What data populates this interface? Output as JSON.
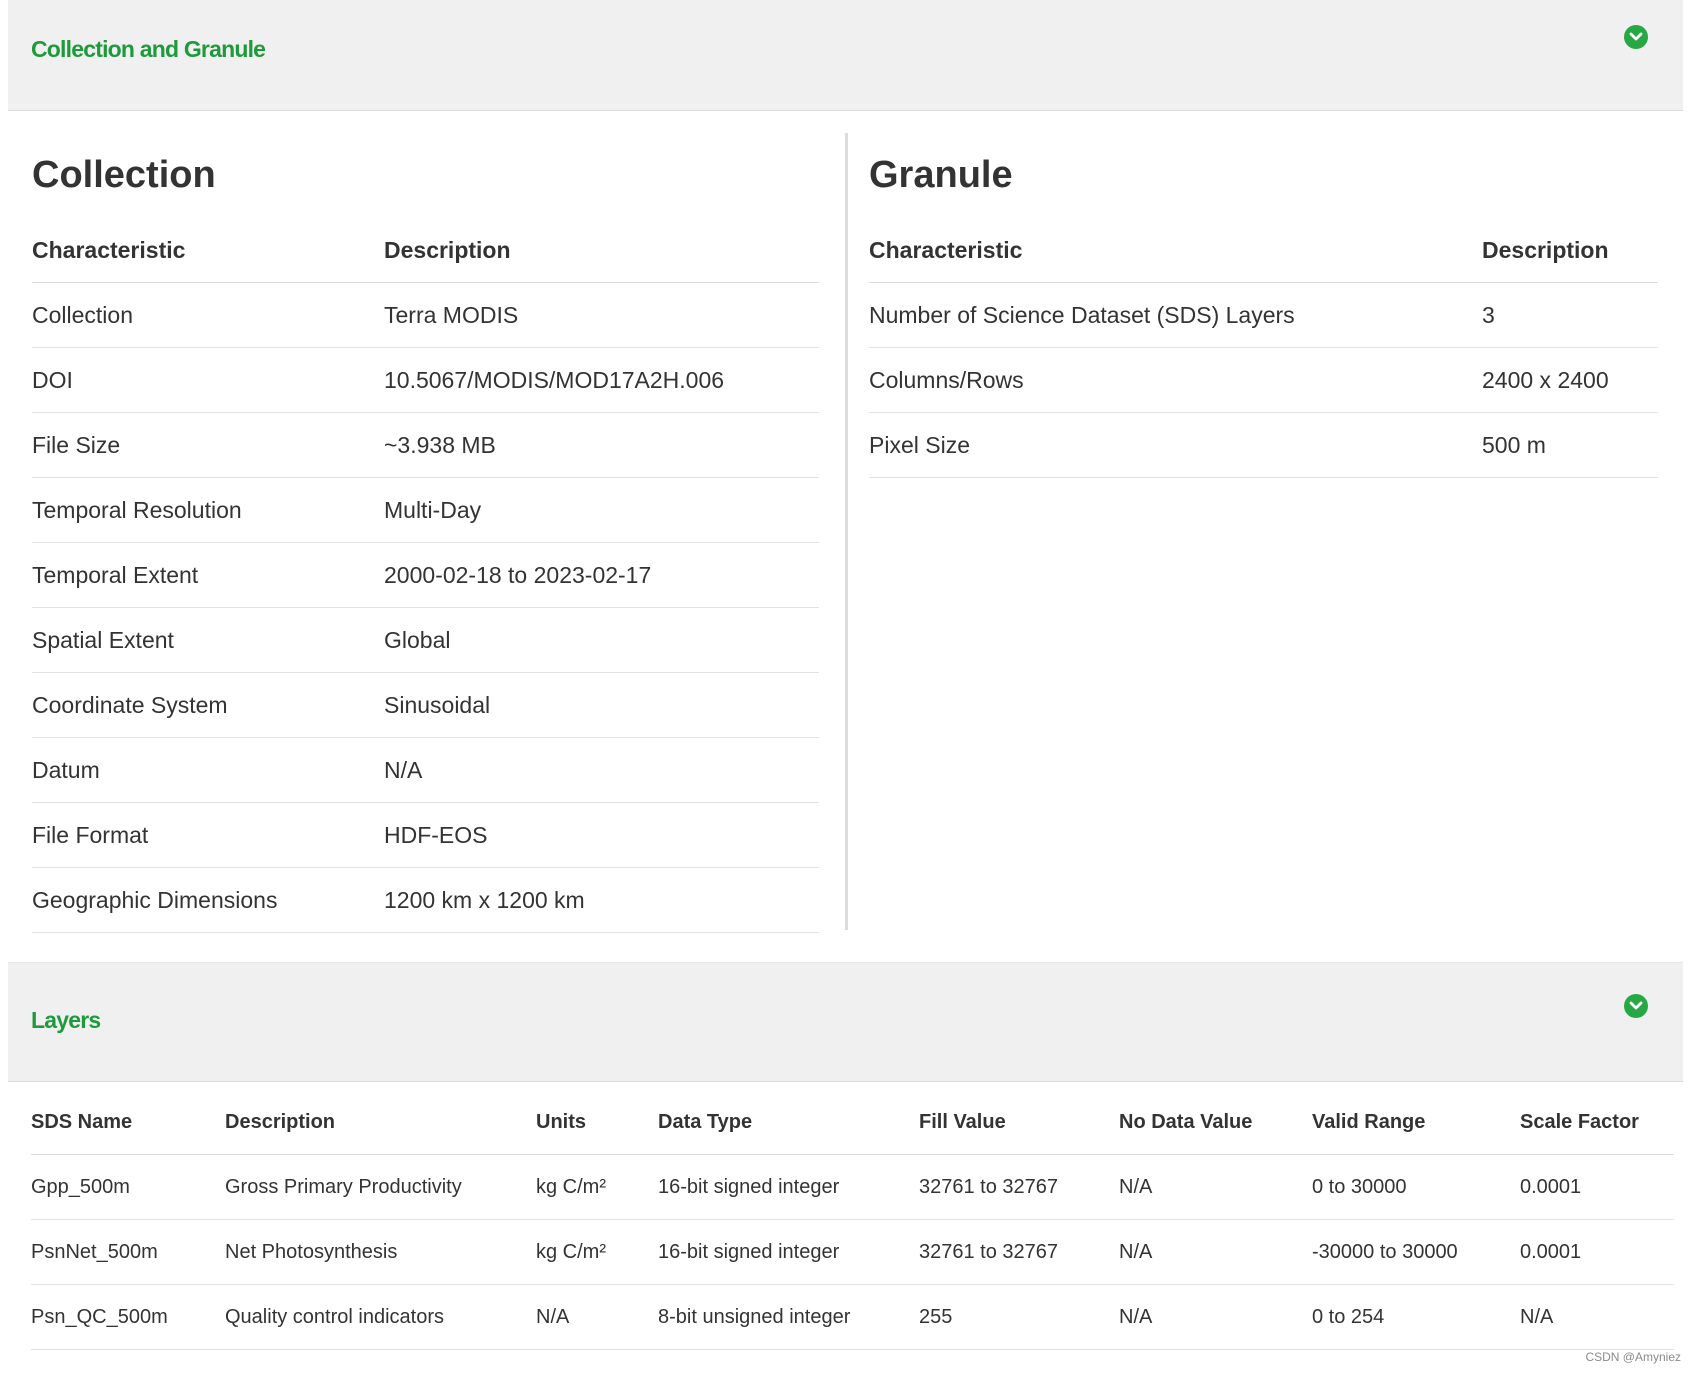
{
  "colors": {
    "accent": "#1e9a3c",
    "header_bg": "#f0f0f0",
    "divider": "#dcdcdc"
  },
  "section1": {
    "title": "Collection and Granule",
    "toggle_icon": "chevron-down-circle-icon"
  },
  "collection": {
    "heading": "Collection",
    "col_characteristic": "Characteristic",
    "col_description": "Description",
    "rows": [
      {
        "k": "Collection",
        "v": "Terra MODIS"
      },
      {
        "k": "DOI",
        "v": "10.5067/MODIS/MOD17A2H.006"
      },
      {
        "k": "File Size",
        "v": "~3.938 MB"
      },
      {
        "k": "Temporal Resolution",
        "v": "Multi-Day"
      },
      {
        "k": "Temporal Extent",
        "v": "2000-02-18 to 2023-02-17"
      },
      {
        "k": "Spatial Extent",
        "v": "Global"
      },
      {
        "k": "Coordinate System",
        "v": "Sinusoidal"
      },
      {
        "k": "Datum",
        "v": "N/A"
      },
      {
        "k": "File Format",
        "v": "HDF-EOS"
      },
      {
        "k": "Geographic Dimensions",
        "v": "1200 km x 1200 km"
      }
    ]
  },
  "granule": {
    "heading": "Granule",
    "col_characteristic": "Characteristic",
    "col_description": "Description",
    "rows": [
      {
        "k": "Number of Science Dataset (SDS) Layers",
        "v": "3"
      },
      {
        "k": "Columns/Rows",
        "v": "2400 x 2400"
      },
      {
        "k": "Pixel Size",
        "v": "500 m"
      }
    ]
  },
  "section2": {
    "title": "Layers",
    "toggle_icon": "chevron-down-circle-icon"
  },
  "layers": {
    "headers": [
      "SDS Name",
      "Description",
      "Units",
      "Data Type",
      "Fill Value",
      "No Data Value",
      "Valid Range",
      "Scale Factor"
    ],
    "rows": [
      [
        "Gpp_500m",
        "Gross Primary Productivity",
        "kg C/m²",
        "16-bit signed integer",
        "32761 to 32767",
        "N/A",
        "0 to 30000",
        "0.0001"
      ],
      [
        "PsnNet_500m",
        "Net Photosynthesis",
        "kg C/m²",
        "16-bit signed integer",
        "32761 to 32767",
        "N/A",
        "-30000 to 30000",
        "0.0001"
      ],
      [
        "Psn_QC_500m",
        "Quality control indicators",
        "N/A",
        "8-bit unsigned integer",
        "255",
        "N/A",
        "0 to 254",
        "N/A"
      ]
    ]
  },
  "watermark": "CSDN @Amyniez"
}
